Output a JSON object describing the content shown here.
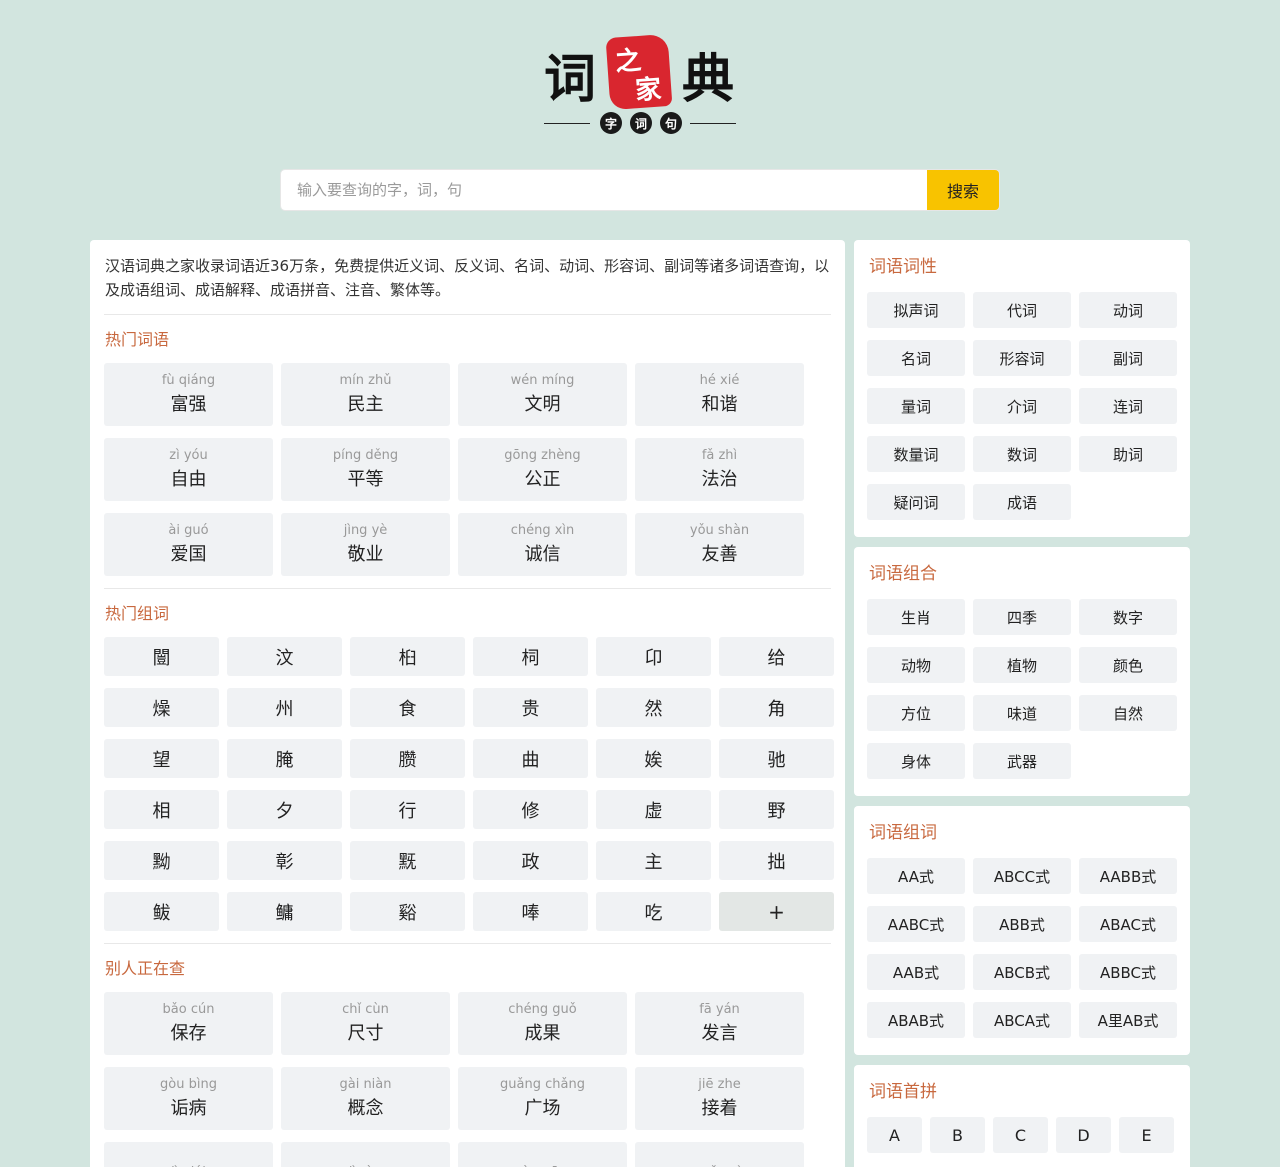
{
  "logo": {
    "chars": [
      "词",
      "之",
      "家",
      "典"
    ],
    "sub": [
      "字",
      "词",
      "句"
    ],
    "seal_color": "#d9262f"
  },
  "search": {
    "placeholder": "输入要查询的字，词，句",
    "button": "搜索",
    "button_color": "#f8c300"
  },
  "intro": "汉语词典之家收录词语近36万条，免费提供近义词、反义词、名词、动词、形容词、副词等诸多词语查询，以及成语组词、成语解释、成语拼音、注音、繁体等。",
  "hot_words": {
    "title": "热门词语",
    "items": [
      {
        "py": "fù qiáng",
        "w": "富强"
      },
      {
        "py": "mín zhǔ",
        "w": "民主"
      },
      {
        "py": "wén míng",
        "w": "文明"
      },
      {
        "py": "hé xié",
        "w": "和谐"
      },
      {
        "py": "zì yóu",
        "w": "自由"
      },
      {
        "py": "píng děng",
        "w": "平等"
      },
      {
        "py": "gōng zhèng",
        "w": "公正"
      },
      {
        "py": "fǎ zhì",
        "w": "法治"
      },
      {
        "py": "ài guó",
        "w": "爱国"
      },
      {
        "py": "jìng yè",
        "w": "敬业"
      },
      {
        "py": "chéng xìn",
        "w": "诚信"
      },
      {
        "py": "yǒu shàn",
        "w": "友善"
      }
    ]
  },
  "hot_chars": {
    "title": "热门组词",
    "items": [
      "闓",
      "汶",
      "桕",
      "柌",
      "卬",
      "给",
      "燥",
      "州",
      "食",
      "贵",
      "然",
      "角",
      "望",
      "腌",
      "臜",
      "曲",
      "娭",
      "驰",
      "相",
      "夕",
      "行",
      "修",
      "虚",
      "野",
      "黝",
      "彰",
      "黖",
      "政",
      "主",
      "拙",
      "鲅",
      "鳙",
      "谿",
      "唪",
      "吃"
    ],
    "more": "+"
  },
  "recent": {
    "title": "别人正在查",
    "items": [
      {
        "py": "bǎo cún",
        "w": "保存"
      },
      {
        "py": "chǐ cùn",
        "w": "尺寸"
      },
      {
        "py": "chéng guǒ",
        "w": "成果"
      },
      {
        "py": "fā yán",
        "w": "发言"
      },
      {
        "py": "gòu bìng",
        "w": "诟病"
      },
      {
        "py": "gài niàn",
        "w": "概念"
      },
      {
        "py": "guǎng chǎng",
        "w": "广场"
      },
      {
        "py": "jiē zhe",
        "w": "接着"
      },
      {
        "py": "jìn lái",
        "w": ""
      },
      {
        "py": "jì rùn",
        "w": ""
      },
      {
        "py": "mù guāng",
        "w": ""
      },
      {
        "py": "mǎn yì",
        "w": ""
      }
    ]
  },
  "side_pos": {
    "title": "词语词性",
    "items": [
      "拟声词",
      "代词",
      "动词",
      "名词",
      "形容词",
      "副词",
      "量词",
      "介词",
      "连词",
      "数量词",
      "数词",
      "助词",
      "疑问词",
      "成语"
    ]
  },
  "side_combo": {
    "title": "词语组合",
    "items": [
      "生肖",
      "四季",
      "数字",
      "动物",
      "植物",
      "颜色",
      "方位",
      "味道",
      "自然",
      "身体",
      "武器"
    ]
  },
  "side_pattern": {
    "title": "词语组词",
    "items": [
      "AA式",
      "ABCC式",
      "AABB式",
      "AABC式",
      "ABB式",
      "ABAC式",
      "AAB式",
      "ABCB式",
      "ABBC式",
      "ABAB式",
      "ABCA式",
      "A里AB式"
    ]
  },
  "side_initial": {
    "title": "词语首拼",
    "items": [
      "A",
      "B",
      "C",
      "D",
      "E"
    ]
  }
}
